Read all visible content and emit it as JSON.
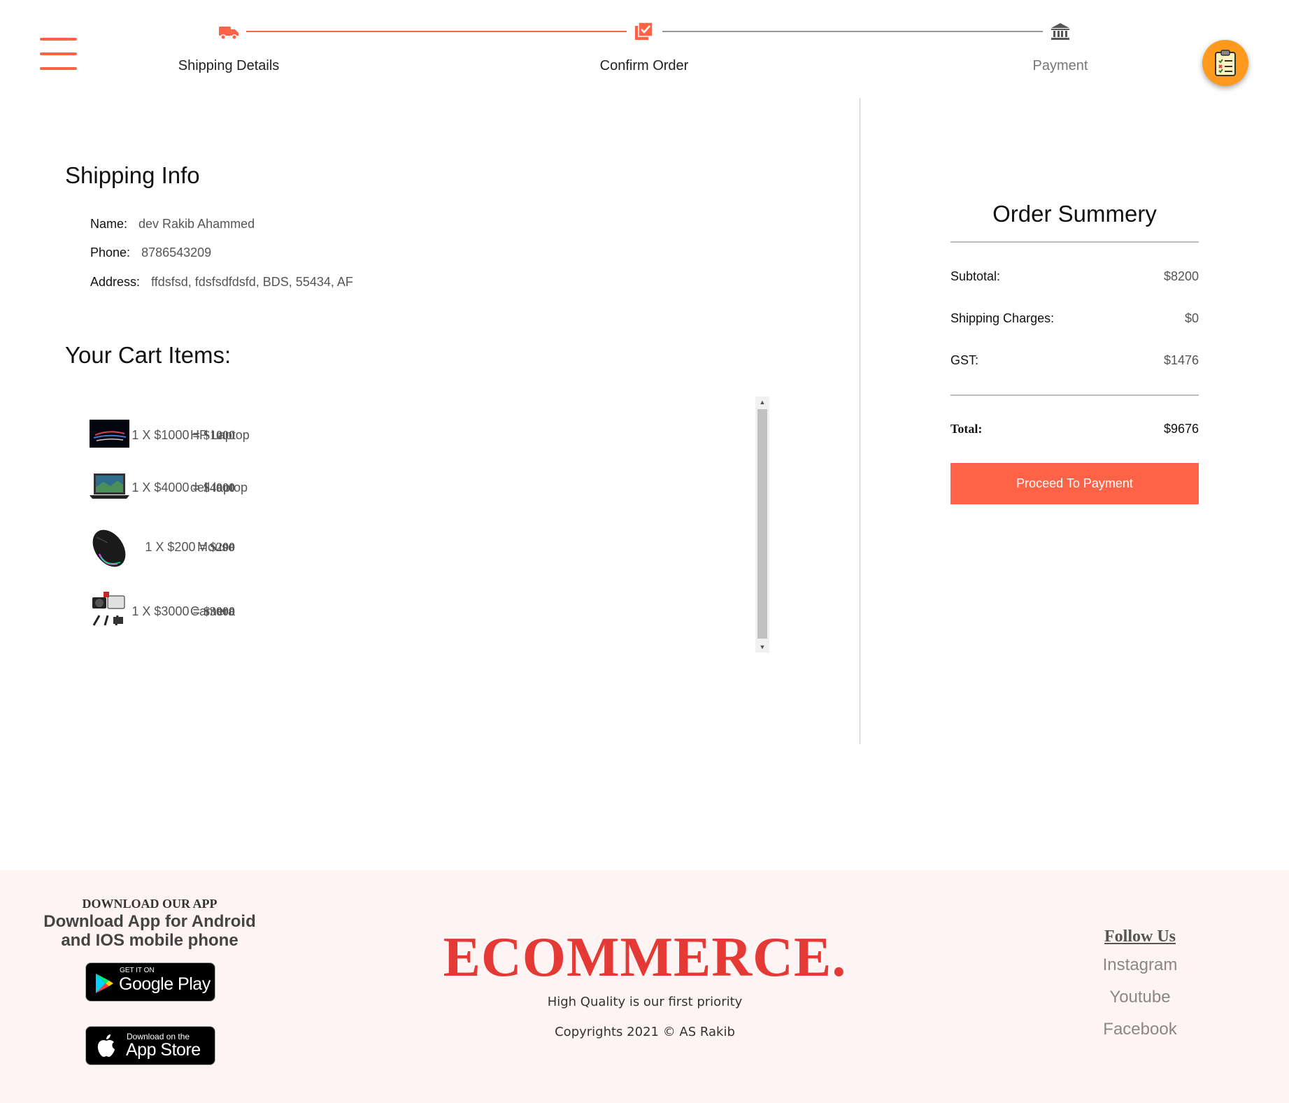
{
  "stepper": {
    "steps": [
      {
        "label": "Shipping Details",
        "icon": "truck-icon",
        "active": true
      },
      {
        "label": "Confirm Order",
        "icon": "checklist-icon",
        "active": true
      },
      {
        "label": "Payment",
        "icon": "bank-icon",
        "active": false
      }
    ]
  },
  "colors": {
    "accent": "#ff6347",
    "inactive": "#555555",
    "brand": "#e53935",
    "footer_bg": "#fdf4f3",
    "speed_dial": "#ff9a1f"
  },
  "shipping": {
    "title": "Shipping Info",
    "name_label": "Name:",
    "name": "dev Rakib Ahammed",
    "phone_label": "Phone:",
    "phone": "8786543209",
    "address_label": "Address:",
    "address": "ffdsfsd, fdsfsdfdsfd, BDS, 55434, AF"
  },
  "cart": {
    "title": "Your Cart Items:",
    "items": [
      {
        "name": "HP Laptop",
        "qty_price": "1 X $1000 =",
        "total": "$1000",
        "image": "laptop-image"
      },
      {
        "name": "dell laptop",
        "qty_price": "1 X $4000 =",
        "total": "$4000",
        "image": "laptop-image"
      },
      {
        "name": "Mouse",
        "qty_price": "1 X $200 =",
        "total": "$200",
        "image": "mouse-image"
      },
      {
        "name": "Camera",
        "qty_price": "1 X $3000 =",
        "total": "$3000",
        "image": "camera-image"
      }
    ]
  },
  "summary": {
    "title": "Order Summery",
    "subtotal_label": "Subtotal:",
    "subtotal": "$8200",
    "shipping_label": "Shipping Charges:",
    "shipping": "$0",
    "gst_label": "GST:",
    "gst": "$1476",
    "total_label": "Total:",
    "total": "$9676",
    "button": "Proceed To Payment"
  },
  "footer": {
    "download_title": "DOWNLOAD OUR APP",
    "download_text_1": "Download App for Android",
    "download_text_2": "and IOS mobile phone",
    "google_small": "GET IT ON",
    "google_big": "Google Play",
    "apple_small": "Download on the",
    "apple_big": "App Store",
    "brand": "ECOMMERCE.",
    "tagline": "High Quality is our first priority",
    "copyright": "Copyrights 2021 © AS Rakib",
    "follow_title": "Follow Us",
    "social": [
      "Instagram",
      "Youtube",
      "Facebook"
    ]
  }
}
